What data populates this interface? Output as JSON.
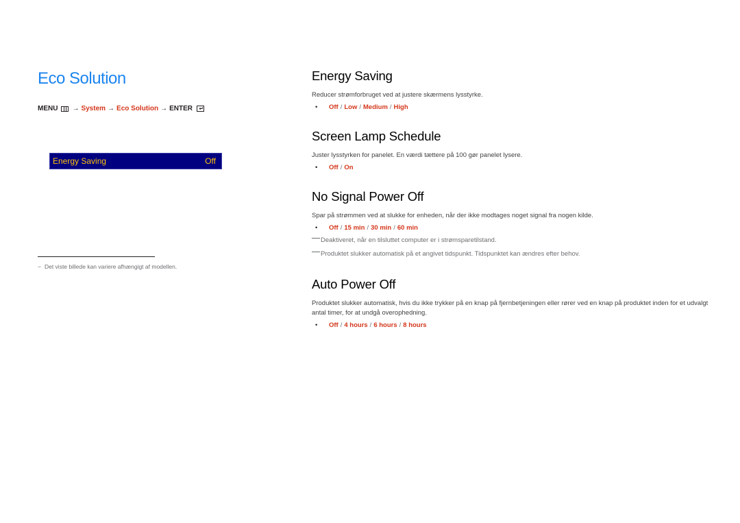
{
  "left": {
    "title": "Eco Solution",
    "menu_path": {
      "menu_label": "MENU",
      "menu_icon": "menu-icon",
      "arrow": "→",
      "system": "System",
      "eco_solution": "Eco Solution",
      "enter_label": "ENTER",
      "enter_icon": "enter-icon"
    },
    "osd": {
      "label": "Energy Saving",
      "value": "Off"
    },
    "footnote": {
      "dash": "−",
      "text": "Det viste billede kan variere afhængigt af modellen."
    }
  },
  "sections": [
    {
      "title": "Energy Saving",
      "description": "Reducer strømforbruget ved at justere skærmens lysstyrke.",
      "bullet": "•",
      "options": [
        "Off",
        "Low",
        "Medium",
        "High"
      ]
    },
    {
      "title": "Screen Lamp Schedule",
      "description": "Juster lysstyrken for panelet. En værdi tættere på 100 gør panelet lysere.",
      "bullet": "•",
      "options": [
        "Off",
        "On"
      ]
    },
    {
      "title": "No Signal Power Off",
      "description": "Spar på strømmen ved at slukke for enheden, når der ikke modtages noget signal fra nogen kilde.",
      "bullet": "•",
      "options": [
        "Off",
        "15 min",
        "30 min",
        "60 min"
      ],
      "notes": [
        "Deaktiveret, når en tilsluttet computer er i strømsparetilstand.",
        "Produktet slukker automatisk på et angivet tidspunkt. Tidspunktet kan ændres efter behov."
      ]
    },
    {
      "title": "Auto Power Off",
      "description": "Produktet slukker automatisk, hvis du ikke trykker på en knap på fjernbetjeningen eller rører ved en knap på produktet inden for et udvalgt antal timer, for at undgå overophedning.",
      "bullet": "•",
      "options": [
        "Off",
        "4 hours",
        "6 hours",
        "8 hours"
      ]
    }
  ],
  "separator": "/"
}
